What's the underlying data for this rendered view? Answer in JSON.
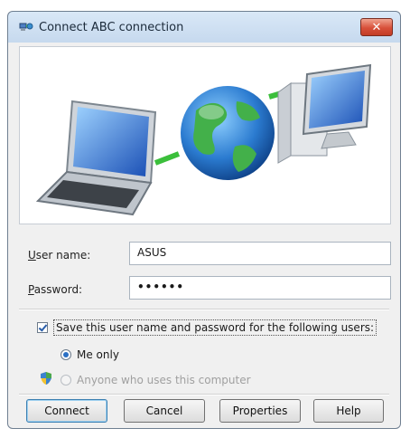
{
  "window": {
    "title": "Connect ABC connection",
    "close_glyph": "✕"
  },
  "form": {
    "username_label_prefix": "U",
    "username_label_rest": "ser name:",
    "username_value": "ASUS",
    "password_label_prefix": "P",
    "password_label_rest": "assword:",
    "password_value": "••••••",
    "save_checkbox_label": "Save this user name and password for the following users:",
    "save_checked": true,
    "radio_me_only_label": "Me only",
    "radio_anyone_label": "Anyone who uses this computer",
    "selected_radio": "Me only"
  },
  "buttons": {
    "connect": "Connect",
    "cancel": "Cancel",
    "properties": "Properties",
    "help": "Help"
  },
  "icons": {
    "title": "network-connection-icon",
    "close": "close-icon",
    "banner": "network-illustration",
    "shield": "uac-shield-icon"
  },
  "colors": {
    "title_gradient": "#d9e8f7",
    "close_button": "#d8503a",
    "radio_selected": "#2a6fc4",
    "link_line": "#3bbf3b"
  }
}
